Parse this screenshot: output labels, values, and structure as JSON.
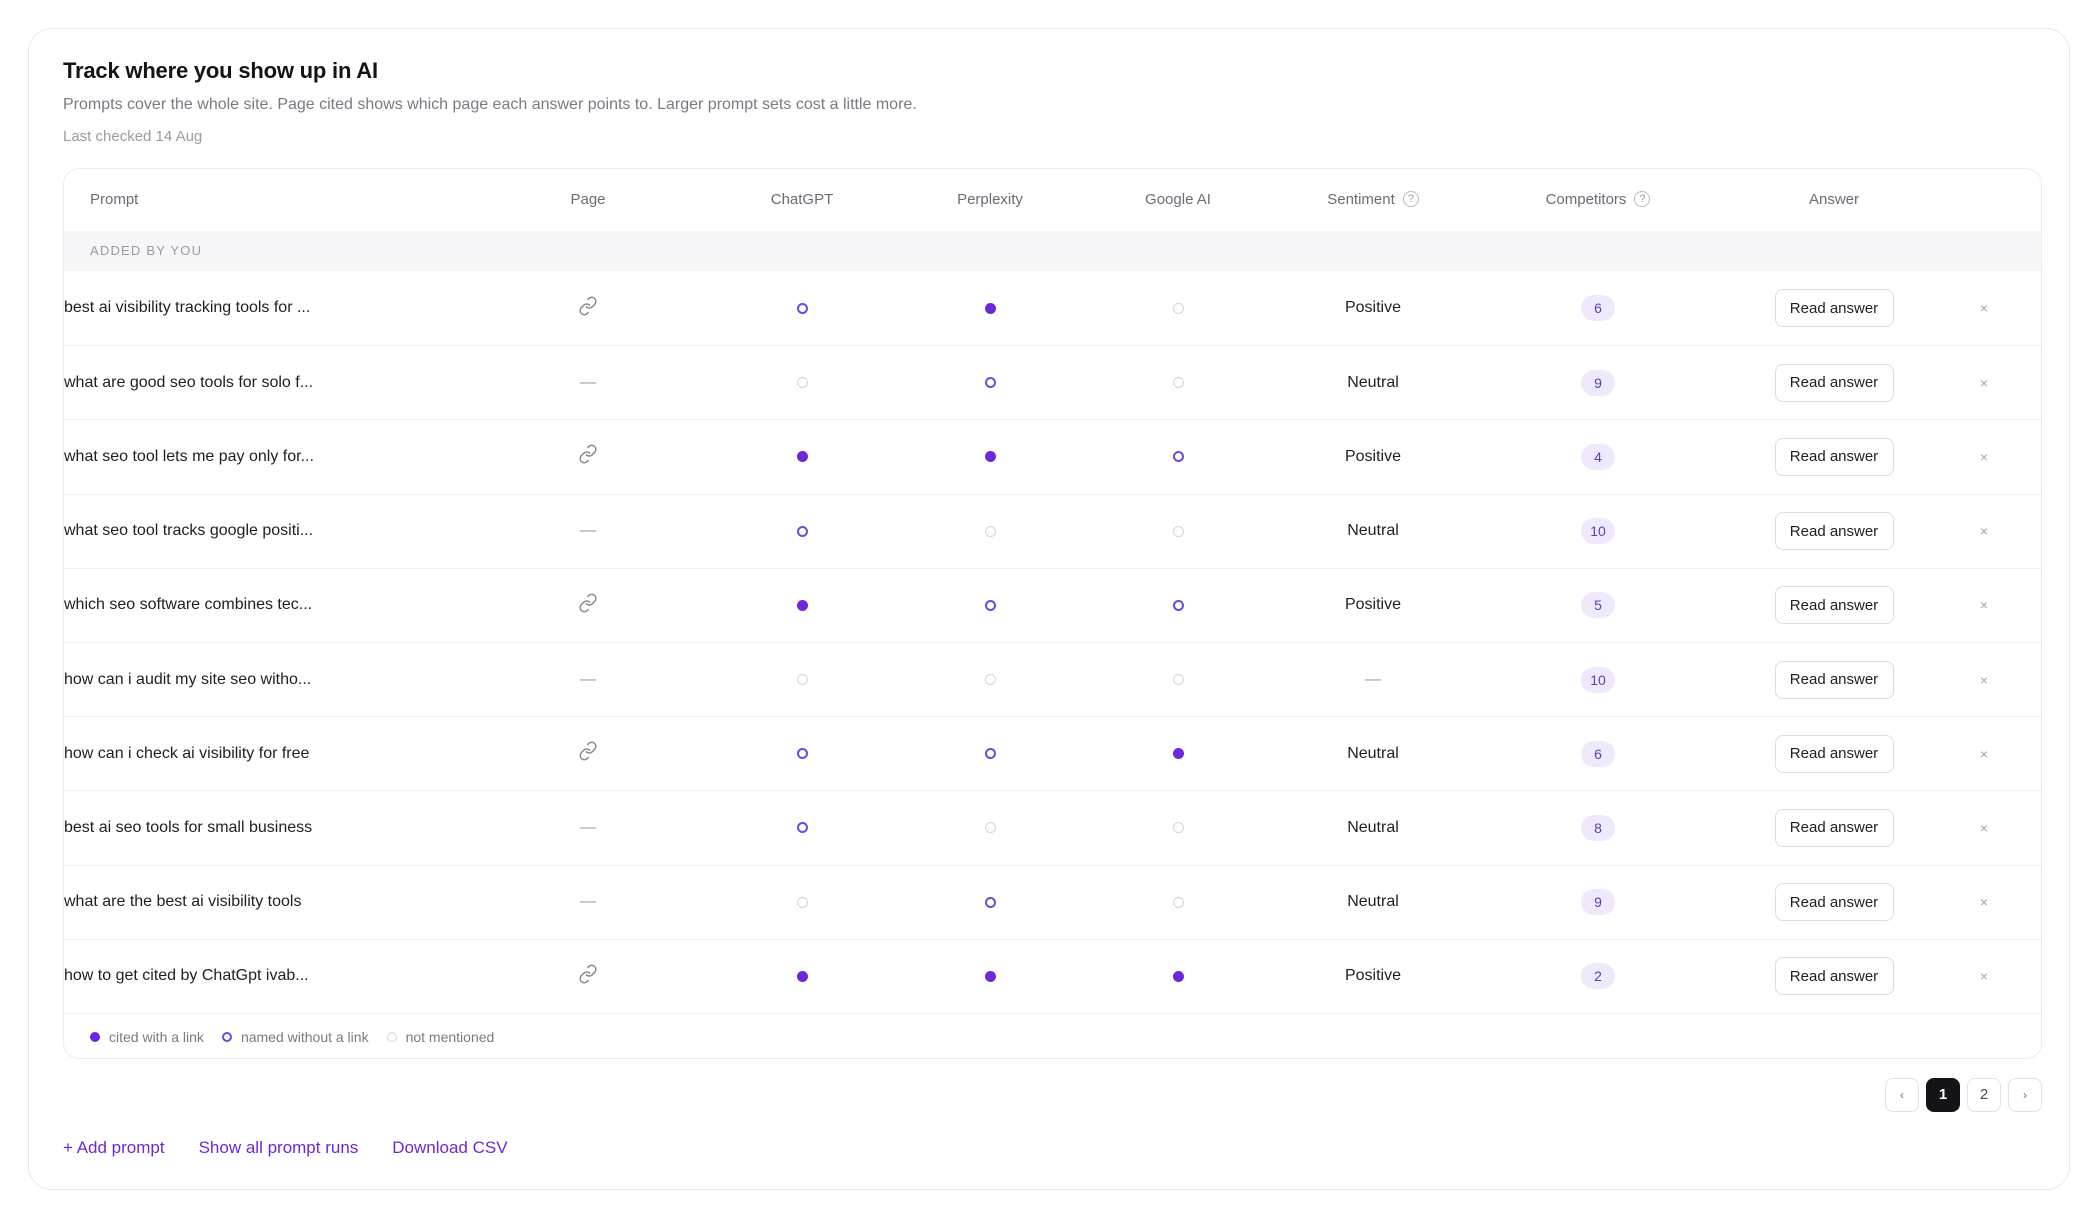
{
  "header": {
    "title": "Track where you show up in AI",
    "subtitle": "Prompts cover the whole site. Page cited shows which page each answer points to. Larger prompt sets cost a little more.",
    "last_checked": "Last checked 14 Aug"
  },
  "table": {
    "columns": {
      "prompt": "Prompt",
      "page": "Page",
      "chatgpt": "ChatGPT",
      "perplexity": "Perplexity",
      "google": "Google AI",
      "sentiment": "Sentiment",
      "competitors": "Competitors",
      "answer": "Answer"
    },
    "help_glyph": "?",
    "group_label": "ADDED BY YOU",
    "read_label": "Read answer",
    "remove_glyph": "×",
    "rows": [
      {
        "prompt": "best ai visibility tracking tools for ...",
        "page": "link",
        "chatgpt": "named",
        "perplexity": "cited",
        "google": "none",
        "sentiment": "Positive",
        "competitors": "6"
      },
      {
        "prompt": "what are good seo tools for solo f...",
        "page": "—",
        "chatgpt": "none",
        "perplexity": "named",
        "google": "none",
        "sentiment": "Neutral",
        "competitors": "9"
      },
      {
        "prompt": "what seo tool lets me pay only for...",
        "page": "link",
        "chatgpt": "cited",
        "perplexity": "cited",
        "google": "named",
        "sentiment": "Positive",
        "competitors": "4"
      },
      {
        "prompt": "what seo tool tracks google positi...",
        "page": "—",
        "chatgpt": "named",
        "perplexity": "none",
        "google": "none",
        "sentiment": "Neutral",
        "competitors": "10"
      },
      {
        "prompt": "which seo software combines tec...",
        "page": "link",
        "chatgpt": "cited",
        "perplexity": "named",
        "google": "named",
        "sentiment": "Positive",
        "competitors": "5"
      },
      {
        "prompt": "how can i audit my site seo witho...",
        "page": "—",
        "chatgpt": "none",
        "perplexity": "none",
        "google": "none",
        "sentiment": "—",
        "competitors": "10"
      },
      {
        "prompt": "how can i check ai visibility for free",
        "page": "link",
        "chatgpt": "named",
        "perplexity": "named",
        "google": "cited",
        "sentiment": "Neutral",
        "competitors": "6"
      },
      {
        "prompt": "best ai seo tools for small business",
        "page": "—",
        "chatgpt": "named",
        "perplexity": "none",
        "google": "none",
        "sentiment": "Neutral",
        "competitors": "8"
      },
      {
        "prompt": "what are the best ai visibility tools",
        "page": "—",
        "chatgpt": "none",
        "perplexity": "named",
        "google": "none",
        "sentiment": "Neutral",
        "competitors": "9"
      },
      {
        "prompt": "how to get cited by ChatGpt ivab...",
        "page": "link",
        "chatgpt": "cited",
        "perplexity": "cited",
        "google": "cited",
        "sentiment": "Positive",
        "competitors": "2"
      }
    ]
  },
  "legend": {
    "cited": "cited with a link",
    "named": "named without a link",
    "none": "not mentioned"
  },
  "pagination": {
    "prev": "‹",
    "pages": [
      "1",
      "2"
    ],
    "current": "1",
    "next": "›"
  },
  "footer": {
    "add_prompt": "+ Add prompt",
    "show_all": "Show all prompt runs",
    "download": "Download CSV"
  },
  "colors": {
    "accent": "#6d28d9",
    "badge_bg": "#efe9fd"
  },
  "icons": {
    "page_link": "link-icon"
  }
}
